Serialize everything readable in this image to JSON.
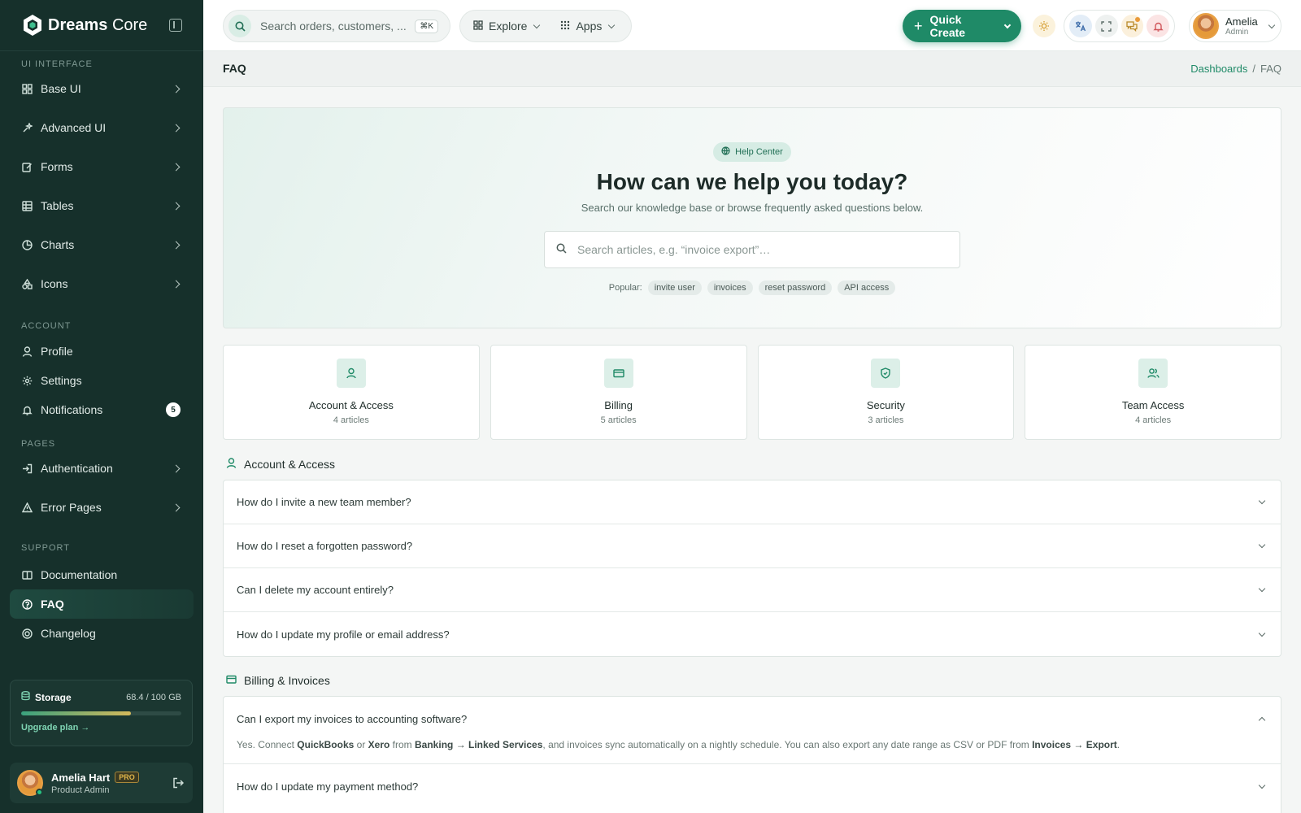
{
  "app": {
    "brand_strong": "Dreams",
    "brand_light": " Core"
  },
  "sidebar": {
    "sections": {
      "ui": "UI INTERFACE",
      "account": "ACCOUNT",
      "pages": "PAGES",
      "support": "SUPPORT"
    },
    "ui_items": [
      "Base UI",
      "Advanced UI",
      "Forms",
      "Tables",
      "Charts",
      "Icons"
    ],
    "account_items": [
      "Profile",
      "Settings",
      "Notifications"
    ],
    "notifications_count": "5",
    "pages_items": [
      "Authentication",
      "Error Pages"
    ],
    "support_items": [
      "Documentation",
      "FAQ",
      "Changelog"
    ],
    "storage": {
      "title": "Storage",
      "value": "68.4 / 100 GB",
      "fraction": 0.684,
      "link": "Upgrade plan →"
    },
    "user": {
      "name": "Amelia Hart",
      "badge": "PRO",
      "role": "Product Admin"
    }
  },
  "topbar": {
    "search_placeholder": "Search orders, customers, ...",
    "shortcut": "⌘K",
    "explore": "Explore",
    "apps": "Apps",
    "quick_create": "Quick Create",
    "user_name": "Amelia",
    "user_role": "Admin"
  },
  "page": {
    "title": "FAQ",
    "crumb_home": "Dashboards",
    "crumb_sep": "/",
    "crumb_current": "FAQ"
  },
  "hero": {
    "chip": "Help Center",
    "title": "How can we help you today?",
    "subtitle": "Search our knowledge base or browse frequently asked questions below.",
    "search_placeholder": "Search articles, e.g. “invoice export”…",
    "popular_label": "Popular:",
    "popular_tags": [
      "invite user",
      "invoices",
      "reset password",
      "API access"
    ]
  },
  "categories": [
    {
      "title": "Account & Access",
      "count": "4 articles",
      "icon": "user-icon"
    },
    {
      "title": "Billing",
      "count": "5 articles",
      "icon": "card-icon"
    },
    {
      "title": "Security",
      "count": "3 articles",
      "icon": "shield-icon"
    },
    {
      "title": "Team Access",
      "count": "4 articles",
      "icon": "users-icon"
    }
  ],
  "faq_account": {
    "title": "Account & Access",
    "questions": [
      "How do I invite a new team member?",
      "How do I reset a forgotten password?",
      "Can I delete my account entirely?",
      "How do I update my profile or email address?"
    ]
  },
  "faq_billing": {
    "title": "Billing & Invoices",
    "open_question": "Can I export my invoices to accounting software?",
    "answer": {
      "p1": "Yes. Connect ",
      "b1": "QuickBooks",
      "p2": " or ",
      "b2": "Xero",
      "p3": " from ",
      "b3": "Banking → Linked Services",
      "p4": ", and invoices sync automatically on a nightly schedule. You can also export any date range as CSV or PDF from ",
      "b4": "Invoices → Export",
      "p5": "."
    },
    "next_question": "How do I update my payment method?"
  },
  "colors": {
    "accent": "#1f8a67",
    "sidebar_bg": "#16302b"
  }
}
